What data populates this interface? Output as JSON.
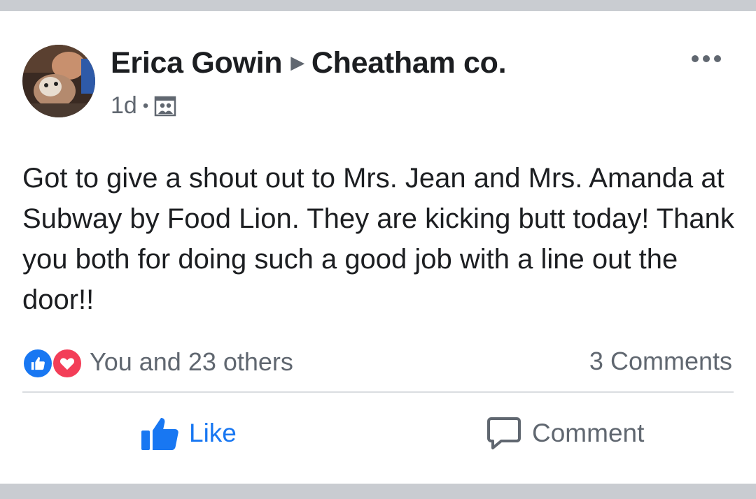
{
  "post": {
    "author": "Erica Gowin",
    "group": "Cheatham co.",
    "separator_icon": "right-triangle-icon",
    "time": "1d",
    "audience_icon": "group-audience-icon",
    "text": "Got to give a shout out to Mrs. Jean and Mrs. Amanda at Subway by Food Lion. They are kicking butt today! Thank you both for doing such a good job with a line out the door!!",
    "menu_icon": "more-options-icon"
  },
  "reactions": {
    "summary": "You and 23 others",
    "icons": [
      "like-reaction-icon",
      "love-reaction-icon"
    ],
    "comments_count": "3 Comments"
  },
  "actions": {
    "like_label": "Like",
    "comment_label": "Comment"
  },
  "colors": {
    "accent": "#1877f2",
    "love": "#f33e58",
    "secondary_text": "#606770",
    "primary_text": "#1c1e21",
    "background": "#c9ccd1"
  }
}
